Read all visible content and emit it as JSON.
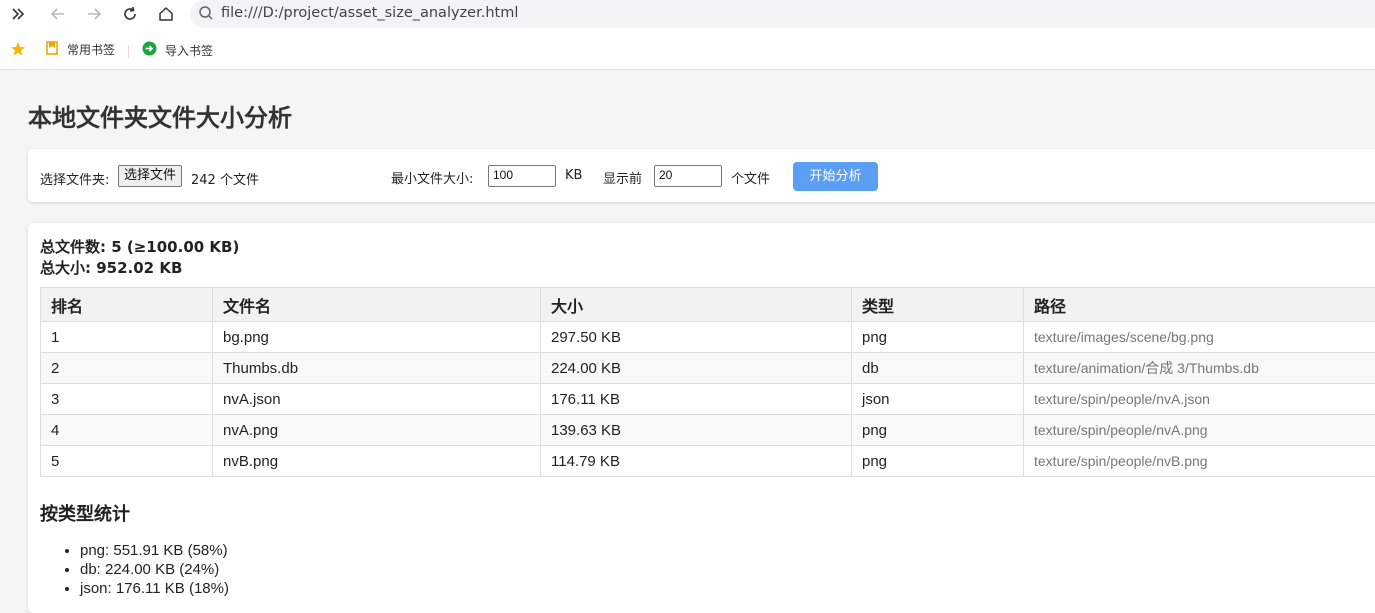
{
  "browser": {
    "url": "file:///D:/project/asset_size_analyzer.html",
    "bookmarks": [
      {
        "label": "常用书签"
      },
      {
        "label": "导入书签"
      }
    ]
  },
  "page": {
    "title": "本地文件夹文件大小分析"
  },
  "controls": {
    "folder_label": "选择文件夹:",
    "file_button_label": "选择文件",
    "file_count_text": "242 个文件",
    "min_size_label": "最小文件大小:",
    "min_size_value": "100",
    "min_size_unit": "KB",
    "top_n_label": "显示前",
    "top_n_value": "20",
    "top_n_unit": "个文件",
    "analyze_button_label": "开始分析"
  },
  "summary": {
    "total_files": "总文件数: 5 (≥100.00 KB)",
    "total_size": "总大小: 952.02 KB"
  },
  "table": {
    "headers": [
      "排名",
      "文件名",
      "大小",
      "类型",
      "路径"
    ],
    "rows": [
      [
        "1",
        "bg.png",
        "297.50 KB",
        "png",
        "texture/images/scene/bg.png"
      ],
      [
        "2",
        "Thumbs.db",
        "224.00 KB",
        "db",
        "texture/animation/合成 3/Thumbs.db"
      ],
      [
        "3",
        "nvA.json",
        "176.11 KB",
        "json",
        "texture/spin/people/nvA.json"
      ],
      [
        "4",
        "nvA.png",
        "139.63 KB",
        "png",
        "texture/spin/people/nvA.png"
      ],
      [
        "5",
        "nvB.png",
        "114.79 KB",
        "png",
        "texture/spin/people/nvB.png"
      ]
    ]
  },
  "type_stats": {
    "title": "按类型统计",
    "items": [
      "png: 551.91 KB (58%)",
      "db: 224.00 KB (24%)",
      "json: 176.11 KB (18%)"
    ]
  }
}
